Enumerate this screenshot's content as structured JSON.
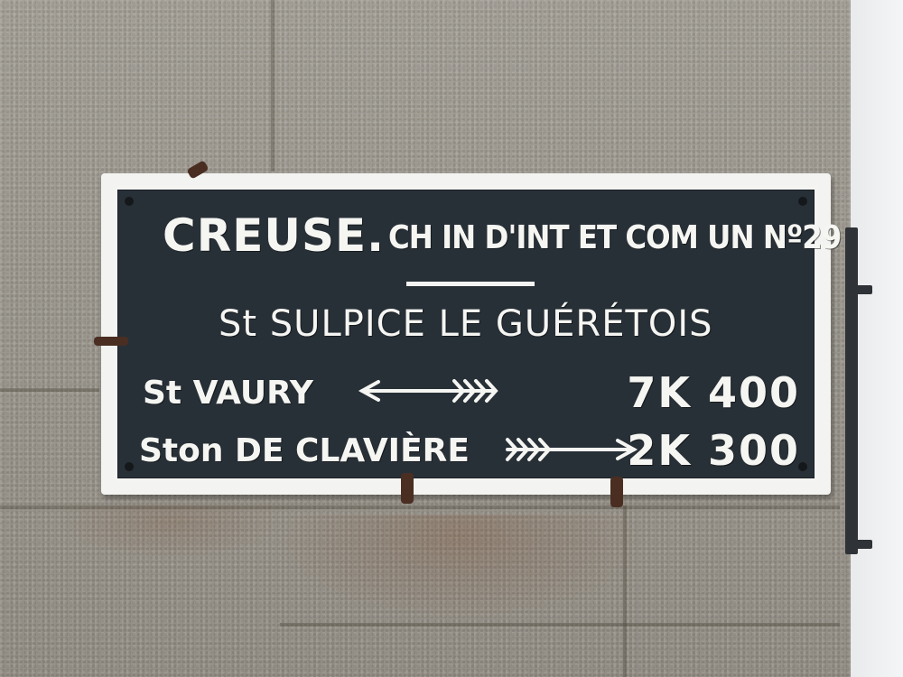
{
  "sign": {
    "department": "CREUSE.",
    "road": "CH IN D'INT ET COM UN Nº29",
    "town": "St SULPICE LE GUÉRÉTOIS",
    "destinations": [
      {
        "name": "St VAURY",
        "arrow": "left-arrow-icon",
        "distance": "7K 400"
      },
      {
        "name": "Ston DE CLAVIÈRE",
        "arrow": "right-arrow-icon",
        "distance": "2K 300"
      }
    ]
  },
  "colors": {
    "panel": "#283037",
    "lettering": "#f5f5f2",
    "wall": "#9d9990"
  }
}
